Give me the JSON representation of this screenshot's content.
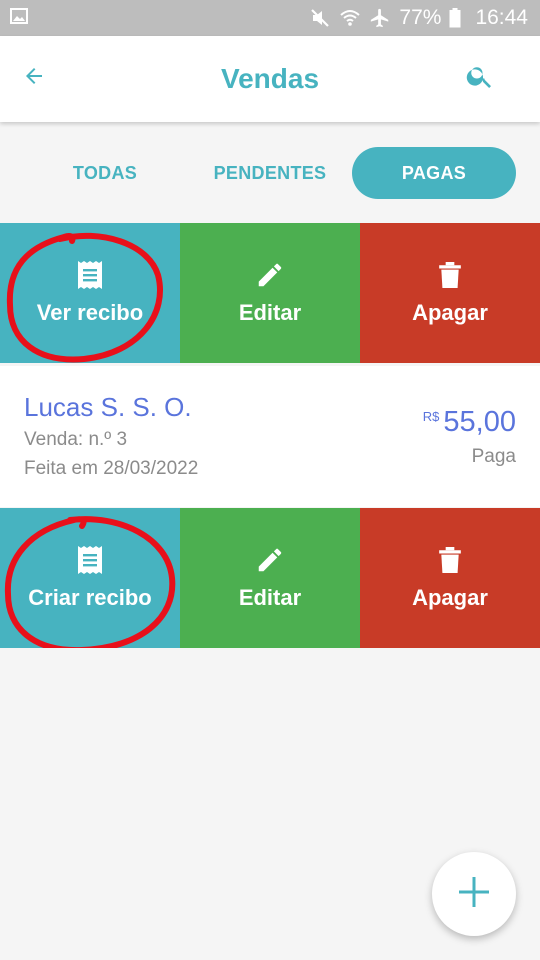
{
  "status_bar": {
    "battery": "77%",
    "time": "16:44",
    "icons": [
      "image-icon",
      "mute-icon",
      "wifi-icon",
      "airplane-icon",
      "battery-icon"
    ]
  },
  "app_bar": {
    "title": "Vendas",
    "back_icon": "arrow-left-icon",
    "search_icon": "search-icon",
    "accent_color": "#47b3c0"
  },
  "tabs": [
    {
      "label": "TODAS",
      "selected": false
    },
    {
      "label": "PENDENTES",
      "selected": false
    },
    {
      "label": "PAGAS",
      "selected": true
    }
  ],
  "action_row_1": {
    "receipt": {
      "label": "Ver recibo",
      "icon": "receipt-icon",
      "color": "#47b3c0"
    },
    "edit": {
      "label": "Editar",
      "icon": "pencil-icon",
      "color": "#4caf50"
    },
    "delete": {
      "label": "Apagar",
      "icon": "trash-icon",
      "color": "#c83b27"
    }
  },
  "sale": {
    "customer": "Lucas S. S. O.",
    "number": "Venda: n.º 3",
    "date": "Feita em 28/03/2022",
    "currency": "R$",
    "amount": "55,00",
    "status": "Paga"
  },
  "action_row_2": {
    "receipt": {
      "label": "Criar recibo",
      "icon": "receipt-icon",
      "color": "#47b3c0"
    },
    "edit": {
      "label": "Editar",
      "icon": "pencil-icon",
      "color": "#4caf50"
    },
    "delete": {
      "label": "Apagar",
      "icon": "trash-icon",
      "color": "#c83b27"
    }
  },
  "fab": {
    "icon": "plus-icon"
  }
}
